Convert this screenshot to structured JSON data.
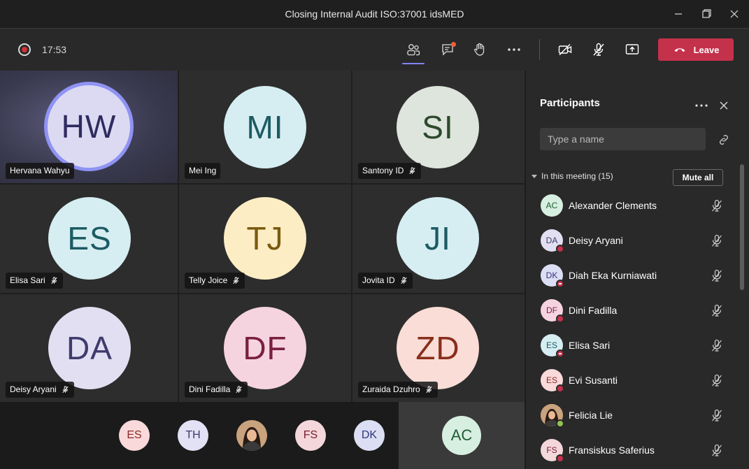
{
  "window": {
    "title": "Closing Internal Audit ISO:37001 idsMED"
  },
  "toolbar": {
    "timer": "17:53",
    "leave_label": "Leave"
  },
  "grid": [
    {
      "initials": "HW",
      "name": "Hervana Wahyu",
      "bg": "#dcdaf2",
      "fg": "#2e2b5f",
      "muted": false,
      "speaking": true
    },
    {
      "initials": "MI",
      "name": "Mei Ing",
      "bg": "#d6eef2",
      "fg": "#1d5b63",
      "muted": false
    },
    {
      "initials": "SI",
      "name": "Santony ID",
      "bg": "#dde5dc",
      "fg": "#2d4a2c",
      "muted": true
    },
    {
      "initials": "ES",
      "name": "Elisa Sari",
      "bg": "#d6eef2",
      "fg": "#1d5b63",
      "muted": true
    },
    {
      "initials": "TJ",
      "name": "Telly Joice",
      "bg": "#fcedc5",
      "fg": "#7a5a0e",
      "muted": true
    },
    {
      "initials": "JI",
      "name": "Jovita ID",
      "bg": "#d6eef2",
      "fg": "#1d5b63",
      "muted": true
    },
    {
      "initials": "DA",
      "name": "Deisy Aryani",
      "bg": "#e1dff1",
      "fg": "#3f3b6e",
      "muted": true
    },
    {
      "initials": "DF",
      "name": "Dini Fadilla",
      "bg": "#f5d4e0",
      "fg": "#7a1f40",
      "muted": true
    },
    {
      "initials": "ZD",
      "name": "Zuraida Dzuhro",
      "bg": "#f9ddd6",
      "fg": "#8a2e1c",
      "muted": true
    }
  ],
  "strip": [
    {
      "initials": "ES",
      "bg": "#f9d9d9",
      "fg": "#8a2a2a"
    },
    {
      "initials": "TH",
      "bg": "#e3e1f4",
      "fg": "#3f3b6e"
    },
    {
      "initials": "",
      "bg": "#b08a6a",
      "fg": "#000",
      "photo": true
    },
    {
      "initials": "FS",
      "bg": "#f4d7da",
      "fg": "#7a2030"
    },
    {
      "initials": "DK",
      "bg": "#dcdff4",
      "fg": "#30357a"
    }
  ],
  "self_avatar": {
    "initials": "AC",
    "bg": "#d7efe0",
    "fg": "#1f5c36"
  },
  "panel": {
    "title": "Participants",
    "search_placeholder": "Type a name",
    "section": "In this meeting (15)",
    "mute_all": "Mute all",
    "participants": [
      {
        "initials": "AC",
        "name": "Alexander Clements",
        "bg": "#d7efe0",
        "fg": "#1f5c36",
        "status": "none"
      },
      {
        "initials": "DA",
        "name": "Deisy Aryani",
        "bg": "#e1dff1",
        "fg": "#3f3b6e",
        "status": "busy"
      },
      {
        "initials": "DK",
        "name": "Diah Eka Kurniawati",
        "bg": "#dcdff4",
        "fg": "#30357a",
        "status": "dnd"
      },
      {
        "initials": "DF",
        "name": "Dini Fadilla",
        "bg": "#f5d4e0",
        "fg": "#7a1f40",
        "status": "busy"
      },
      {
        "initials": "ES",
        "name": "Elisa Sari",
        "bg": "#d6eef2",
        "fg": "#1d5b63",
        "status": "dnd"
      },
      {
        "initials": "ES",
        "name": "Evi Susanti",
        "bg": "#f9d9d9",
        "fg": "#8a2a2a",
        "status": "busy"
      },
      {
        "initials": "",
        "name": "Felicia Lie",
        "bg": "#b08a6a",
        "fg": "#000",
        "status": "avail",
        "photo": true
      },
      {
        "initials": "FS",
        "name": "Fransiskus Saferius",
        "bg": "#f4d7da",
        "fg": "#7a2030",
        "status": "busy"
      }
    ]
  },
  "colors": {
    "accent": "#7f85f5",
    "leave": "#c4314b",
    "busy": "#c4314b",
    "available": "#92c353"
  }
}
